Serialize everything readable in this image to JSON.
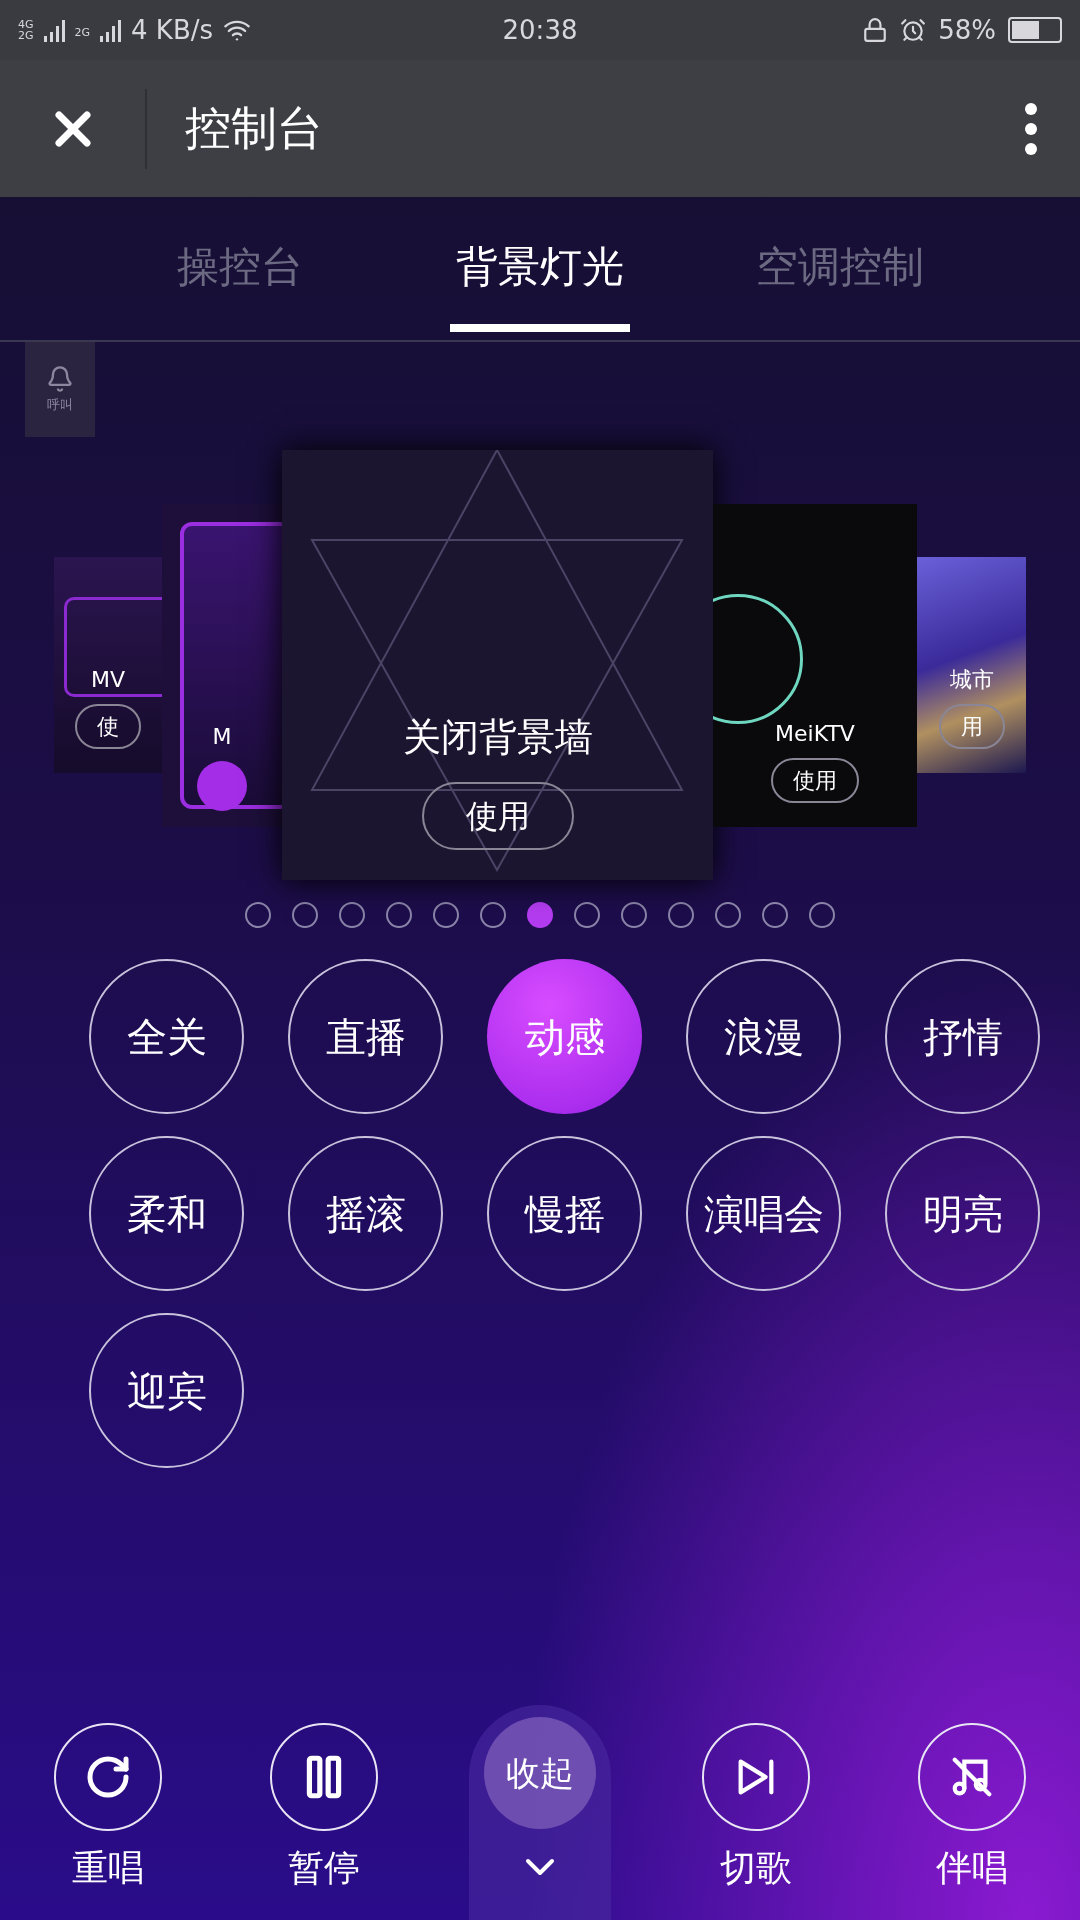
{
  "status_bar": {
    "network_labels": [
      "4G",
      "2G",
      "2G"
    ],
    "speed": "4 KB/s",
    "time": "20:38",
    "battery": "58%"
  },
  "header": {
    "title": "控制台"
  },
  "tabs": [
    {
      "label": "操控台",
      "selected": false
    },
    {
      "label": "背景灯光",
      "selected": true
    },
    {
      "label": "空调控制",
      "selected": false
    }
  ],
  "call_button": {
    "label": "呼叫"
  },
  "scenes": [
    {
      "kind": "mv",
      "title": "MV",
      "button": "使",
      "selected": false
    },
    {
      "kind": "mv2",
      "title": "M",
      "selected": false
    },
    {
      "kind": "off",
      "title": "关闭背景墙",
      "button": "使用",
      "selected": true
    },
    {
      "kind": "mei",
      "title": "MeiKTV",
      "button": "使用",
      "selected": false
    },
    {
      "kind": "city",
      "title": "城市",
      "button": "用",
      "selected": false
    }
  ],
  "page_dots": [
    {
      "selected": false
    },
    {
      "selected": false
    },
    {
      "selected": false
    },
    {
      "selected": false
    },
    {
      "selected": false
    },
    {
      "selected": false
    },
    {
      "selected": true
    },
    {
      "selected": false
    },
    {
      "selected": false
    },
    {
      "selected": false
    },
    {
      "selected": false
    },
    {
      "selected": false
    },
    {
      "selected": false
    }
  ],
  "modes": [
    {
      "label": "全关",
      "selected": false
    },
    {
      "label": "直播",
      "selected": false
    },
    {
      "label": "动感",
      "selected": true
    },
    {
      "label": "浪漫",
      "selected": false
    },
    {
      "label": "抒情",
      "selected": false
    },
    {
      "label": "柔和",
      "selected": false
    },
    {
      "label": "摇滚",
      "selected": false
    },
    {
      "label": "慢摇",
      "selected": false
    },
    {
      "label": "演唱会",
      "selected": false
    },
    {
      "label": "明亮",
      "selected": false
    },
    {
      "label": "迎宾",
      "selected": false
    }
  ],
  "controls": [
    {
      "kind": "replay",
      "label": "重唱"
    },
    {
      "kind": "pause",
      "label": "暂停"
    },
    {
      "kind": "skip",
      "label": "切歌"
    },
    {
      "kind": "accompany",
      "label": "伴唱"
    }
  ],
  "collapse": {
    "label": "收起"
  }
}
